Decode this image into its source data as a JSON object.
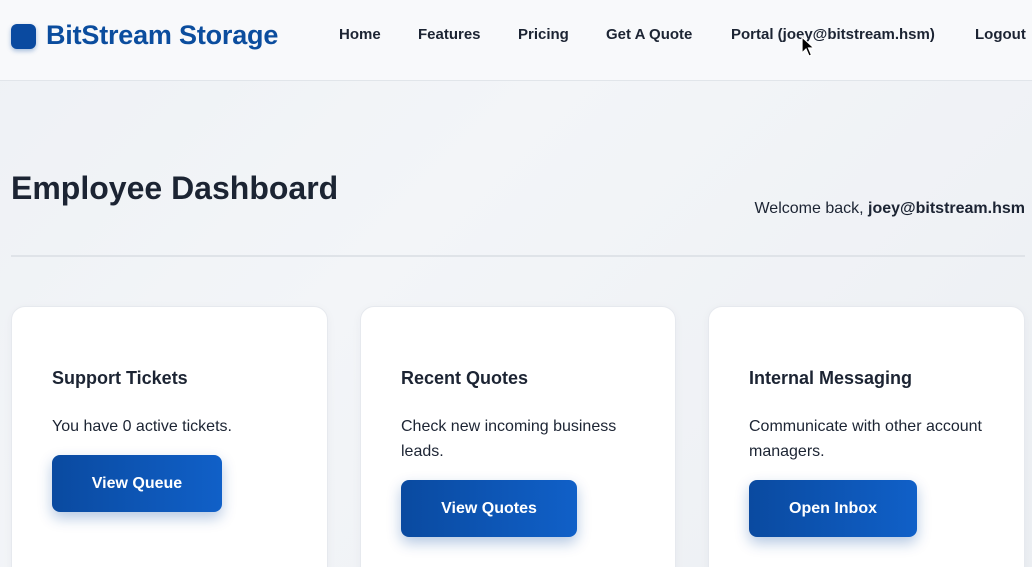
{
  "brand": {
    "name": "BitStream Storage",
    "accent": "#0a4aa0"
  },
  "nav": {
    "home": "Home",
    "features": "Features",
    "pricing": "Pricing",
    "quote": "Get A Quote",
    "portal": "Portal (joey@bitstream.hsm)",
    "logout": "Logout"
  },
  "page": {
    "title": "Employee Dashboard",
    "welcome_prefix": "Welcome back, ",
    "welcome_user": "joey@bitstream.hsm"
  },
  "cards": [
    {
      "title": "Support Tickets",
      "text": "You have 0 active tickets.",
      "button": "View Queue"
    },
    {
      "title": "Recent Quotes",
      "text": "Check new incoming business leads.",
      "button": "View Quotes"
    },
    {
      "title": "Internal Messaging",
      "text": "Communicate with other account managers.",
      "button": "Open Inbox"
    }
  ]
}
